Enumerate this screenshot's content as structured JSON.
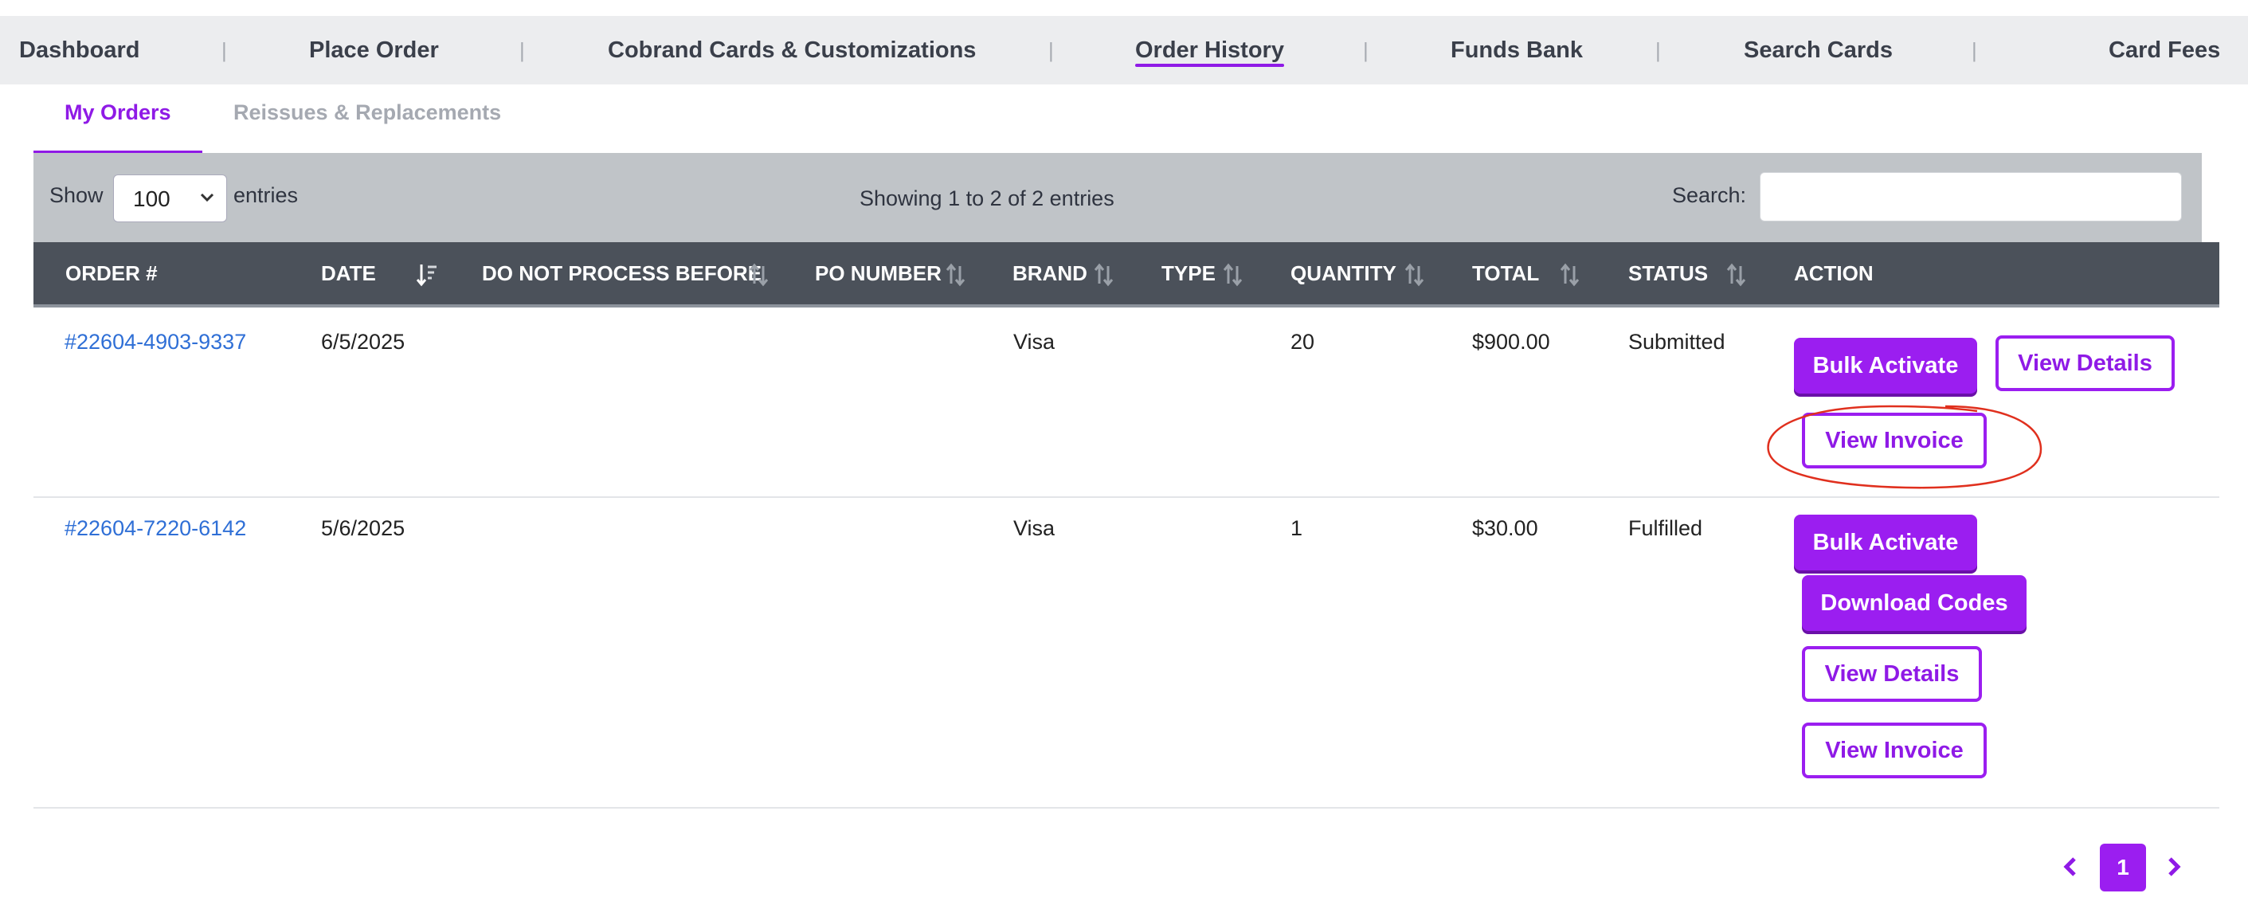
{
  "nav": {
    "items": [
      {
        "label": "Dashboard"
      },
      {
        "label": "Place Order"
      },
      {
        "label": "Cobrand Cards & Customizations"
      },
      {
        "label": "Order History"
      },
      {
        "label": "Funds Bank"
      },
      {
        "label": "Search Cards"
      },
      {
        "label": "Card Fees"
      }
    ],
    "active": "Order History",
    "separator": "|"
  },
  "subtabs": [
    {
      "label": "My Orders",
      "active": true
    },
    {
      "label": "Reissues & Replacements",
      "active": false
    }
  ],
  "controls": {
    "show_label": "Show",
    "entries_value": "100",
    "entries_label": "entries",
    "info": "Showing 1 to 2 of 2 entries",
    "search_label": "Search:",
    "search_value": ""
  },
  "table": {
    "columns": [
      "ORDER #",
      "DATE",
      "DO NOT PROCESS BEFORE",
      "PO NUMBER",
      "BRAND",
      "TYPE",
      "QUANTITY",
      "TOTAL",
      "STATUS",
      "ACTION"
    ],
    "rows": [
      {
        "order": "#22604-4903-9337",
        "date": "6/5/2025",
        "do_not_process_before": "",
        "po_number": "",
        "brand": "Visa",
        "type": "",
        "quantity": "20",
        "total": "$900.00",
        "status": "Submitted",
        "actions": [
          "Bulk Activate",
          "View Details",
          "View Invoice"
        ]
      },
      {
        "order": "#22604-7220-6142",
        "date": "5/6/2025",
        "do_not_process_before": "",
        "po_number": "",
        "brand": "Visa",
        "type": "",
        "quantity": "1",
        "total": "$30.00",
        "status": "Fulfilled",
        "actions": [
          "Bulk Activate",
          "Download Codes",
          "View Details",
          "View Invoice"
        ]
      }
    ]
  },
  "pagination": {
    "prev_icon": "chevron-left-icon",
    "current": "1",
    "next_icon": "chevron-right-icon"
  },
  "colors": {
    "accent": "#9b1ef0",
    "header_bg": "#4b515a",
    "controls_bg": "#c0c4c8",
    "link": "#2f6fd6",
    "annotation": "#e0301e"
  }
}
